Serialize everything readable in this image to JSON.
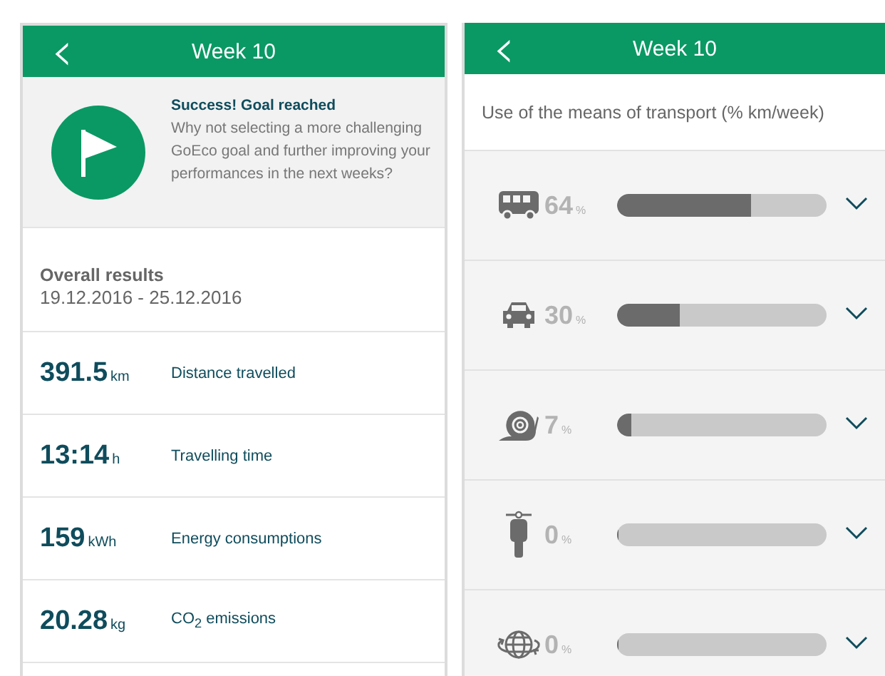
{
  "screens": [
    {
      "kind": "summary",
      "header": {
        "back": "‹",
        "title": "Week 10"
      },
      "goal": {
        "title": "Success! Goal reached",
        "message": "Why not selecting a more challenging GoEco goal and further improving your performances in the next weeks?"
      },
      "overall": {
        "title": "Overall results",
        "period": "19.12.2016 - 25.12.2016"
      },
      "stats": [
        {
          "value": "391.5",
          "unit": "km",
          "label": "Distance travelled"
        },
        {
          "value": "13:14",
          "unit": "h",
          "label": "Travelling time"
        },
        {
          "value": "159",
          "unit": "kWh",
          "label": "Energy consumptions"
        },
        {
          "value": "20.28",
          "unit": "kg",
          "label": "CO$_{2}$ emissions"
        }
      ]
    },
    {
      "kind": "transport",
      "header": {
        "back": "‹",
        "title": "Week 10"
      },
      "subtitle": "Use of the means of transport (% km/week)",
      "modes": [
        {
          "kind": "bus",
          "value": "64",
          "unit": "%",
          "level": 0.64,
          "expanded": false
        },
        {
          "kind": "car",
          "value": "30",
          "unit": "%",
          "level": 0.3,
          "expanded": false
        },
        {
          "kind": "snail",
          "value": "7",
          "unit": "%",
          "level": 0.07,
          "expanded": false
        },
        {
          "kind": "scooter",
          "value": "0",
          "unit": "%",
          "level": 0,
          "expanded": false
        },
        {
          "kind": "globe",
          "value": "0",
          "unit": "%",
          "level": 0,
          "expanded": false
        }
      ]
    }
  ]
}
